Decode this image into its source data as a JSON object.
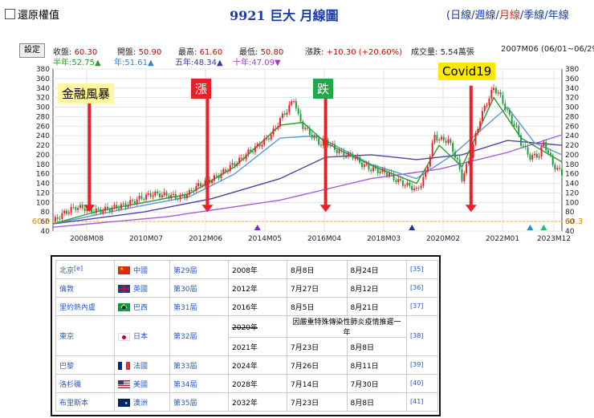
{
  "header": {
    "restore_label": "還原權值",
    "title": "9921 巨大  月線圖",
    "period_open": "(",
    "periods": [
      "日線",
      "週線",
      "月線",
      "季線",
      "年線"
    ],
    "active_period": "月線",
    "period_close": ")"
  },
  "toolbar": {
    "settings_label": "設定"
  },
  "info": {
    "close_label": "收盤:",
    "close_value": "60.30",
    "open_label": "開盤:",
    "open_value": "50.90",
    "high_label": "最高:",
    "high_value": "61.60",
    "low_label": "最低:",
    "low_value": "50.80",
    "change_label": "漲跌:",
    "change_value": "+10.30 (+20.60%)",
    "volume_label": "成交量:",
    "volume_value": "5.54萬張",
    "date_range": "2007M06 (06/01~06/29",
    "ma_half": "半年:52.75▲",
    "ma_one": "年:51.61▲",
    "ma_five": "五年:48.34▲",
    "ma_ten": "十年:47.09▼"
  },
  "annotations": {
    "crisis": "金融風暴",
    "rise": "漲",
    "fall": "跌",
    "covid": "Covid19"
  },
  "chart_data": {
    "type": "candlestick",
    "ylim": [
      40,
      380
    ],
    "yticks": [
      40,
      60,
      80,
      100,
      120,
      140,
      160,
      180,
      200,
      220,
      240,
      260,
      280,
      300,
      320,
      340,
      360,
      380
    ],
    "last_price_label": "60.3",
    "xticks": [
      "2008M08",
      "2010M07",
      "2012M06",
      "2014M05",
      "2016M04",
      "2018M03",
      "2020M02",
      "2022M01",
      "2023M12"
    ],
    "colors": {
      "up": "#e8202a",
      "down": "#1c9e3a",
      "ma_half": "#2f9a2f",
      "ma_one": "#5a9bd5",
      "ma_five": "#5040a0",
      "ma_ten": "#a45dd8"
    },
    "price_points": [
      [
        0,
        60
      ],
      [
        5,
        78
      ],
      [
        10,
        90
      ],
      [
        14,
        88
      ],
      [
        18,
        82
      ],
      [
        22,
        84
      ],
      [
        26,
        88
      ],
      [
        32,
        95
      ],
      [
        38,
        108
      ],
      [
        44,
        118
      ],
      [
        50,
        115
      ],
      [
        56,
        110
      ],
      [
        60,
        120
      ],
      [
        62,
        130
      ],
      [
        66,
        140
      ],
      [
        70,
        148
      ],
      [
        74,
        160
      ],
      [
        78,
        175
      ],
      [
        82,
        188
      ],
      [
        86,
        205
      ],
      [
        90,
        218
      ],
      [
        94,
        232
      ],
      [
        98,
        255
      ],
      [
        100,
        275
      ],
      [
        104,
        300
      ],
      [
        106,
        318
      ],
      [
        108,
        280
      ],
      [
        110,
        260
      ],
      [
        114,
        240
      ],
      [
        118,
        222
      ],
      [
        120,
        230
      ],
      [
        124,
        212
      ],
      [
        128,
        200
      ],
      [
        132,
        198
      ],
      [
        136,
        180
      ],
      [
        140,
        170
      ],
      [
        144,
        166
      ],
      [
        148,
        160
      ],
      [
        150,
        150
      ],
      [
        154,
        140
      ],
      [
        158,
        132
      ],
      [
        160,
        125
      ],
      [
        162,
        140
      ],
      [
        164,
        160
      ],
      [
        166,
        200
      ],
      [
        168,
        240
      ],
      [
        170,
        232
      ],
      [
        174,
        230
      ],
      [
        176,
        210
      ],
      [
        178,
        185
      ],
      [
        180,
        150
      ],
      [
        184,
        200
      ],
      [
        186,
        240
      ],
      [
        188,
        275
      ],
      [
        190,
        300
      ],
      [
        192,
        320
      ],
      [
        194,
        340
      ],
      [
        196,
        330
      ],
      [
        198,
        310
      ],
      [
        200,
        290
      ],
      [
        202,
        270
      ],
      [
        204,
        255
      ],
      [
        206,
        225
      ],
      [
        208,
        210
      ],
      [
        210,
        195
      ],
      [
        214,
        200
      ],
      [
        216,
        225
      ],
      [
        218,
        205
      ],
      [
        220,
        180
      ],
      [
        222,
        170
      ],
      [
        224,
        160
      ]
    ],
    "ma_half": [
      [
        0,
        55
      ],
      [
        20,
        82
      ],
      [
        40,
        100
      ],
      [
        60,
        118
      ],
      [
        80,
        175
      ],
      [
        100,
        262
      ],
      [
        110,
        268
      ],
      [
        120,
        225
      ],
      [
        140,
        178
      ],
      [
        160,
        140
      ],
      [
        170,
        220
      ],
      [
        180,
        175
      ],
      [
        194,
        320
      ],
      [
        206,
        235
      ],
      [
        224,
        185
      ]
    ],
    "ma_one": [
      [
        0,
        55
      ],
      [
        30,
        85
      ],
      [
        60,
        112
      ],
      [
        80,
        160
      ],
      [
        100,
        235
      ],
      [
        116,
        240
      ],
      [
        140,
        180
      ],
      [
        160,
        150
      ],
      [
        176,
        200
      ],
      [
        200,
        300
      ],
      [
        212,
        225
      ],
      [
        224,
        200
      ]
    ],
    "ma_five": [
      [
        0,
        55
      ],
      [
        40,
        80
      ],
      [
        70,
        108
      ],
      [
        100,
        150
      ],
      [
        120,
        195
      ],
      [
        140,
        200
      ],
      [
        160,
        190
      ],
      [
        180,
        200
      ],
      [
        200,
        230
      ],
      [
        224,
        220
      ]
    ],
    "ma_ten": [
      [
        0,
        48
      ],
      [
        50,
        70
      ],
      [
        100,
        105
      ],
      [
        140,
        150
      ],
      [
        170,
        170
      ],
      [
        200,
        205
      ],
      [
        224,
        242
      ]
    ],
    "markers": [
      {
        "x": 90,
        "color": "#7a2ac8"
      },
      {
        "x": 158,
        "color": "#1a3a8a"
      },
      {
        "x": 210,
        "color": "#2a8ad0"
      },
      {
        "x": 216,
        "color": "#20c060"
      }
    ],
    "event_arrows": [
      {
        "label": "金融風暴",
        "x": 16,
        "y_top": 330,
        "y_bottom": 80
      },
      {
        "label": "漲",
        "x": 68,
        "y_top": 330,
        "y_bottom": 80
      },
      {
        "label": "跌",
        "x": 120,
        "y_top": 330,
        "y_bottom": 80
      },
      {
        "label": "Covid19",
        "x": 184,
        "y_top": 345,
        "y_bottom": 80
      }
    ]
  },
  "olympics_table": {
    "rows": [
      {
        "city": "北京",
        "city_ref": "[e]",
        "country": "中國",
        "flag": "cn",
        "edition": "第29屆",
        "year": "2008年",
        "start": "8月8日",
        "end": "8月24日",
        "ref": "[35]"
      },
      {
        "city": "倫敦",
        "city_ref": "",
        "country": "英國",
        "flag": "uk",
        "edition": "第30屆",
        "year": "2012年",
        "start": "7月27日",
        "end": "8月12日",
        "ref": "[36]"
      },
      {
        "city": "里約熱內盧",
        "city_ref": "",
        "country": "巴西",
        "flag": "br",
        "edition": "第31屆",
        "year": "2016年",
        "start": "8月5日",
        "end": "8月21日",
        "ref": "[37]"
      },
      {
        "city": "東京",
        "city_ref": "",
        "country": "日本",
        "flag": "jp",
        "edition": "第32屆",
        "year": "2020年",
        "note": "因嚴重特殊傳染性肺炎疫情推遲一年",
        "year2": "2021年",
        "start": "7月23日",
        "end": "8月8日",
        "ref": "[38]"
      },
      {
        "city": "巴黎",
        "city_ref": "",
        "country": "法國",
        "flag": "fr",
        "edition": "第33屆",
        "year": "2024年",
        "start": "7月26日",
        "end": "8月11日",
        "ref": "[39]"
      },
      {
        "city": "洛杉磯",
        "city_ref": "",
        "country": "美國",
        "flag": "us",
        "edition": "第34屆",
        "year": "2028年",
        "start": "7月14日",
        "end": "7月30日",
        "ref": "[40]"
      },
      {
        "city": "布里斯本",
        "city_ref": "",
        "country": "澳洲",
        "flag": "au",
        "edition": "第35屆",
        "year": "2032年",
        "start": "7月23日",
        "end": "8月8日",
        "ref": "[41]"
      }
    ]
  }
}
